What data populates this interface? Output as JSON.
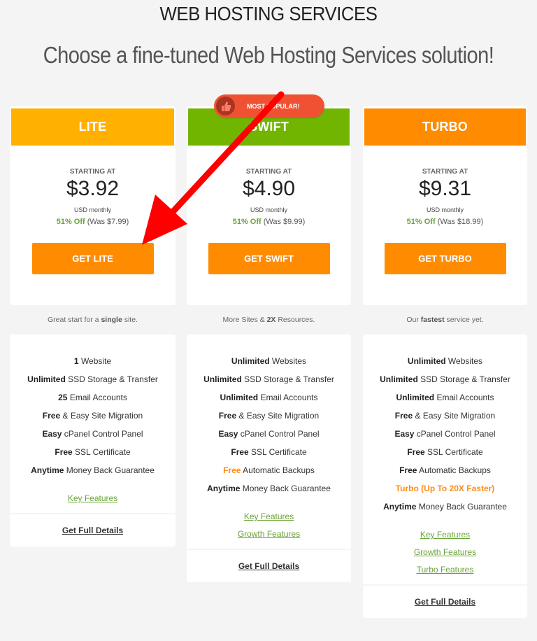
{
  "page": {
    "title": "WEB HOSTING SERVICES",
    "subtitle": "Choose a fine-tuned Web Hosting Services solution!"
  },
  "badge": {
    "label": "MOST POPULAR!",
    "icon": "thumbs-up-icon"
  },
  "colors": {
    "background": "#f4f4f4",
    "lite_header": "#ffb000",
    "swift_header": "#72b500",
    "turbo_header": "#ff8c00",
    "button": "#ff8c00",
    "discount_green": "#6aa338",
    "highlight_orange": "#ff8c1a",
    "badge": "#f05133",
    "annotation_arrow": "#ff0000"
  },
  "plans": [
    {
      "name": "LITE",
      "starting_label": "STARTING AT",
      "price": "$3.92",
      "period": "USD monthly",
      "discount": "51% Off",
      "was": "(Was $7.99)",
      "button": "GET LITE",
      "tagline": {
        "pre": "Great start for a ",
        "bold": "single",
        "post": " site."
      },
      "features": [
        {
          "bold": "1",
          "text": " Website"
        },
        {
          "bold": "Unlimited",
          "text": " SSD Storage & Transfer"
        },
        {
          "bold": "25",
          "text": " Email Accounts"
        },
        {
          "bold": "Free",
          "text": " & Easy Site Migration"
        },
        {
          "bold": "Easy",
          "text": " cPanel Control Panel"
        },
        {
          "bold": "Free",
          "text": " SSL Certificate"
        },
        {
          "bold": "Anytime",
          "text": " Money Back Guarantee"
        }
      ],
      "links": [
        "Key Features"
      ],
      "details": "Get Full Details"
    },
    {
      "name": "SWIFT",
      "starting_label": "STARTING AT",
      "price": "$4.90",
      "period": "USD monthly",
      "discount": "51% Off",
      "was": "(Was $9.99)",
      "button": "GET SWIFT",
      "tagline": {
        "pre": "More Sites & ",
        "bold": "2X",
        "post": " Resources."
      },
      "features": [
        {
          "bold": "Unlimited",
          "text": " Websites"
        },
        {
          "bold": "Unlimited",
          "text": " SSD Storage & Transfer"
        },
        {
          "bold": "Unlimited",
          "text": " Email Accounts"
        },
        {
          "bold": "Free",
          "text": " & Easy Site Migration"
        },
        {
          "bold": "Easy",
          "text": " cPanel Control Panel"
        },
        {
          "bold": "Free",
          "text": " SSL Certificate"
        },
        {
          "bold": "Free",
          "text": " Automatic Backups",
          "highlight": "bold"
        },
        {
          "bold": "Anytime",
          "text": " Money Back Guarantee"
        }
      ],
      "links": [
        "Key Features",
        "Growth Features"
      ],
      "details": "Get Full Details"
    },
    {
      "name": "TURBO",
      "starting_label": "STARTING AT",
      "price": "$9.31",
      "period": "USD monthly",
      "discount": "51% Off",
      "was": "(Was $18.99)",
      "button": "GET TURBO",
      "tagline": {
        "pre": "Our ",
        "bold": "fastest",
        "post": " service yet."
      },
      "features": [
        {
          "bold": "Unlimited",
          "text": " Websites"
        },
        {
          "bold": "Unlimited",
          "text": " SSD Storage & Transfer"
        },
        {
          "bold": "Unlimited",
          "text": " Email Accounts"
        },
        {
          "bold": "Free",
          "text": " & Easy Site Migration"
        },
        {
          "bold": "Easy",
          "text": " cPanel Control Panel"
        },
        {
          "bold": "Free",
          "text": " SSL Certificate"
        },
        {
          "bold": "Free",
          "text": " Automatic Backups"
        },
        {
          "bold": "Turbo (Up To 20X Faster)",
          "text": "",
          "highlight": "all"
        },
        {
          "bold": "Anytime",
          "text": " Money Back Guarantee"
        }
      ],
      "links": [
        "Key Features",
        "Growth Features",
        "Turbo Features"
      ],
      "details": "Get Full Details"
    }
  ]
}
